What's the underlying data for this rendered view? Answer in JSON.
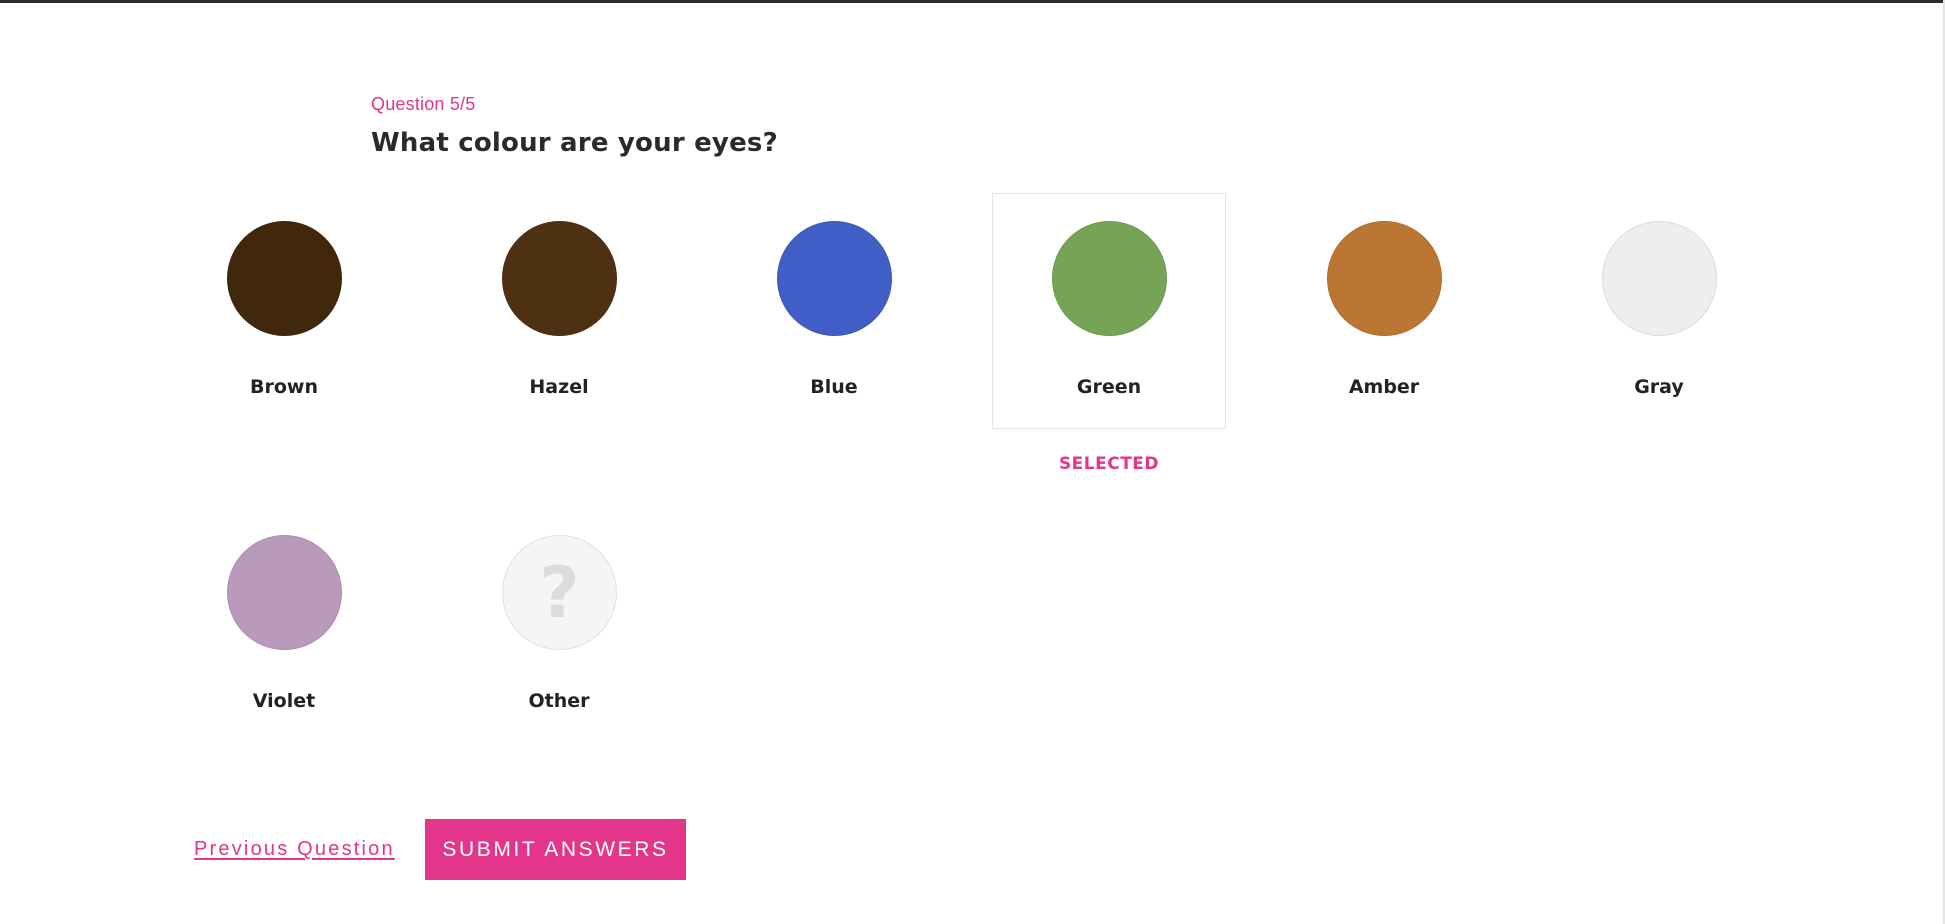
{
  "question": {
    "counter": "Question 5/5",
    "title": "What colour are your eyes?"
  },
  "options": [
    {
      "label": "Brown",
      "color": "#41270b",
      "selected": false
    },
    {
      "label": "Hazel",
      "color": "#4e3113",
      "selected": false
    },
    {
      "label": "Blue",
      "color": "#405ec5",
      "selected": false
    },
    {
      "label": "Green",
      "color": "#75a456",
      "selected": true
    },
    {
      "label": "Amber",
      "color": "#bb7633",
      "selected": false
    },
    {
      "label": "Gray",
      "color": "#eeeeee",
      "selected": false
    },
    {
      "label": "Violet",
      "color": "#ba9aba",
      "selected": false
    },
    {
      "label": "Other",
      "color": "#f5f5f5",
      "selected": false,
      "icon": "question-mark-icon",
      "icon_glyph": "?"
    }
  ],
  "selected_badge": "SELECTED",
  "navigation": {
    "previous_label": "Previous Question",
    "submit_label": "SUBMIT ANSWERS"
  },
  "colors": {
    "accent": "#e3358a",
    "text": "#222222"
  }
}
